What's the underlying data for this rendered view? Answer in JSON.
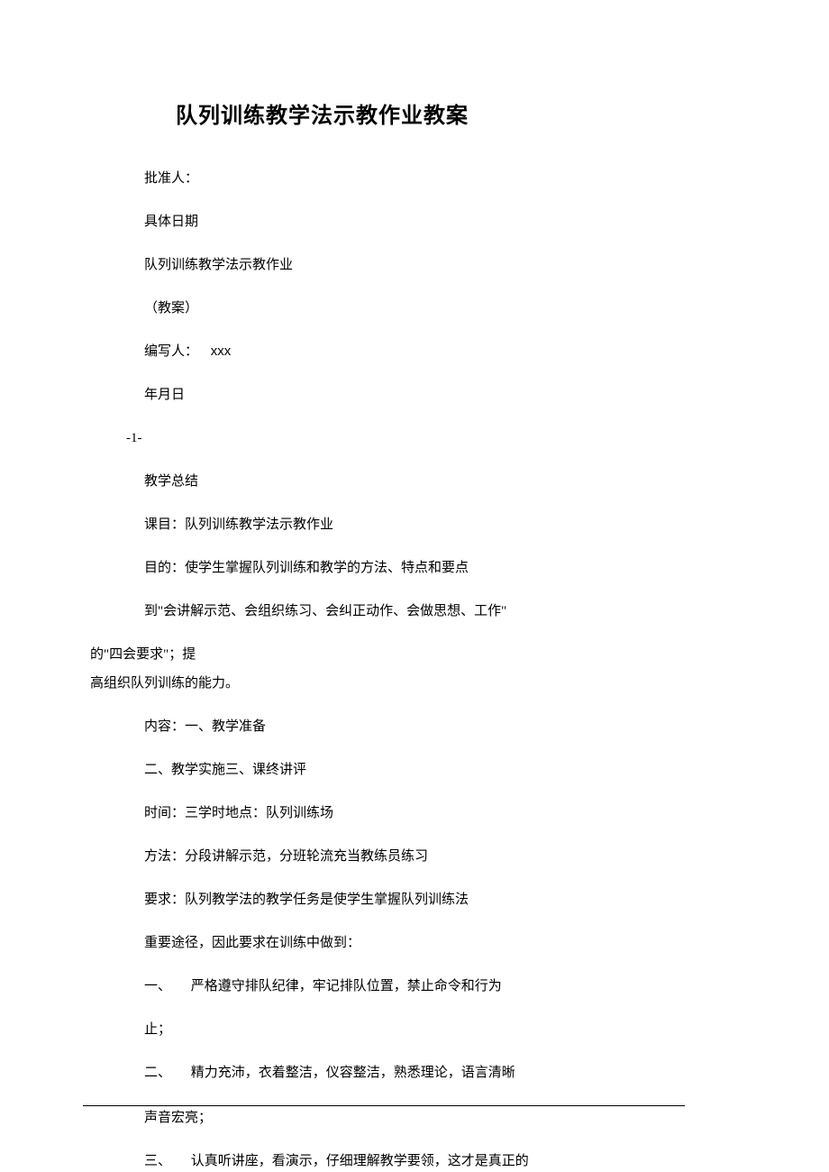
{
  "title": "队列训练教学法示教作业教案",
  "approver_label": "批准人：",
  "date_label": "具体日期",
  "subject_line": "队列训练教学法示教作业",
  "plan_label": "（教案）",
  "author_label": "编写人：",
  "author_value": "xxx",
  "date_fields": "年月日",
  "page_marker": "-1-",
  "summary_heading": "教学总结",
  "course_line": "课目：队列训练教学法示教作业",
  "purpose_line": "目的：使学生掌握队列训练和教学的方法、特点和要点",
  "purpose_detail1": "到\"会讲解示范、会组织练习、会纠正动作、会做思想、工作\"",
  "purpose_detail2": "的\"四会要求\"；提",
  "purpose_detail3": "高组织队列训练的能力。",
  "content_line": "内容：一、教学准备",
  "content_line2": "二、教学实施三、课终讲评",
  "time_place_line": "时间：三学时地点：队列训练场",
  "method_line": "方法：分段讲解示范，分班轮流充当教练员练习",
  "requirement_line": "要求：队列教学法的教学任务是使学生掌握队列训练法",
  "important_line": "重要途径，因此要求在训练中做到：",
  "item1_num": "一、",
  "item1_text": "严格遵守排队纪律，牢记排队位置，禁止命令和行为",
  "item1_end": "止；",
  "item2_num": "二、",
  "item2_text": "精力充沛，衣着整洁，仪容整洁，熟悉理论，语言清晰",
  "item2_end": "声音宏亮；",
  "item3_num": "三、",
  "item3_text": "认真听讲座，看演示，仔细理解教学要领，这才是真正的"
}
